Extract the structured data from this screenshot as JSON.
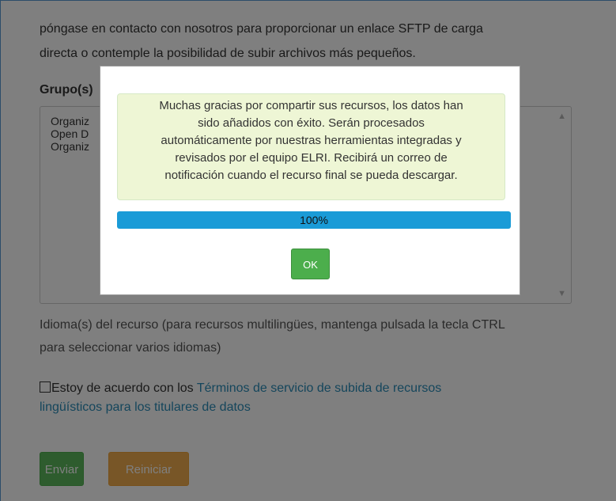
{
  "form": {
    "intro_line1": "póngase en contacto con nosotros para proporcionar un enlace SFTP de carga",
    "intro_line2": "directa o contemple la posibilidad de subir archivos más pequeños.",
    "group_label": "Grupo(s)",
    "group_options": [
      "Organiz",
      "Open D",
      "Organiz"
    ],
    "language_help_line1": "Idioma(s) del recurso (para recursos multilingües, mantenga pulsada la tecla CTRL",
    "language_help_line2": "para seleccionar varios idiomas)",
    "agree_text": "Estoy de acuerdo con los ",
    "terms_link_line1": "Términos de servicio de subida de recursos",
    "terms_link_line2": "lingüísticos para los titulares de datos",
    "submit_label": "Enviar",
    "reset_label": "Reiniciar"
  },
  "modal": {
    "message_lines": [
      "Muchas gracias por compartir sus recursos, los datos han",
      "sido añadidos con éxito. Serán procesados",
      "automáticamente por nuestras herramientas integradas y",
      "revisados por el equipo ELRI. Recibirá un correo de",
      "notificación cuando el recurso final se pueda descargar."
    ],
    "progress_percent": 100,
    "progress_label": "100%",
    "ok_label": "OK"
  },
  "colors": {
    "primary_blue": "#1a9bd7",
    "success_green": "#5cb85c",
    "warning_orange": "#f0ad4e",
    "link_blue": "#2a8cb8",
    "alert_bg": "#eef6d5"
  },
  "icons": {
    "scroll_up": "chevron-up-icon",
    "scroll_down": "chevron-down-icon",
    "checkbox": "checkbox-unchecked"
  }
}
